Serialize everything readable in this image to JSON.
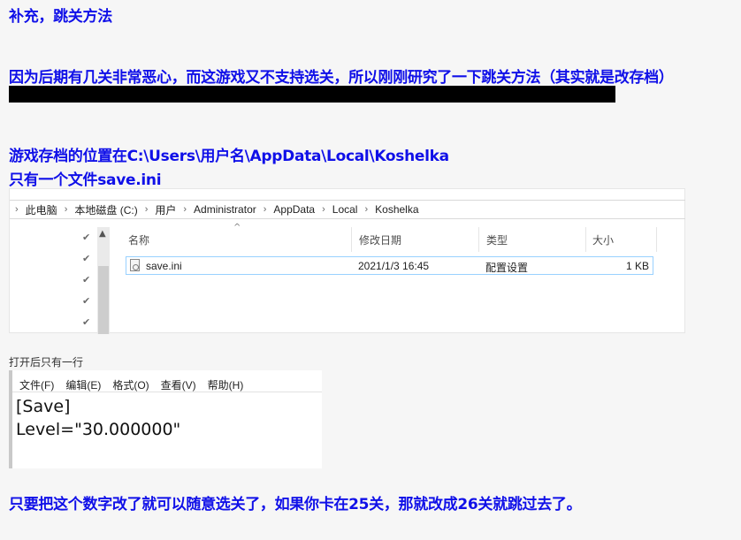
{
  "heading": "补充，跳关方法",
  "intro": "因为后期有几关非常恶心，而这游戏又不支持选关，所以刚刚研究了一下跳关方法（其实就是改存档）",
  "save_location": "游戏存档的位置在C:\\Users\\用户名\\AppData\\Local\\Koshelka",
  "only_one_file": "只有一个文件save.ini",
  "explorer": {
    "breadcrumb": [
      "此电脑",
      "本地磁盘 (C:)",
      "用户",
      "Administrator",
      "AppData",
      "Local",
      "Koshelka"
    ],
    "columns": {
      "name": "名称",
      "modified": "修改日期",
      "type": "类型",
      "size": "大小"
    },
    "rows": [
      {
        "name": "save.ini",
        "modified": "2021/1/3 16:45",
        "type": "配置设置",
        "size": "1 KB"
      }
    ]
  },
  "open_note": "打开后只有一行",
  "notepad": {
    "menu": [
      "文件(F)",
      "编辑(E)",
      "格式(O)",
      "查看(V)",
      "帮助(H)"
    ],
    "line1": "[Save]",
    "line2": "Level=\"30.000000\""
  },
  "conclusion": "只要把这个数字改了就可以随意选关了，如果你卡在25关，那就改成26关就跳过去了。",
  "colors": {
    "heading_blue": "#1010e8",
    "redacted_bar": "#000000",
    "selection_border": "#99d1ff"
  }
}
